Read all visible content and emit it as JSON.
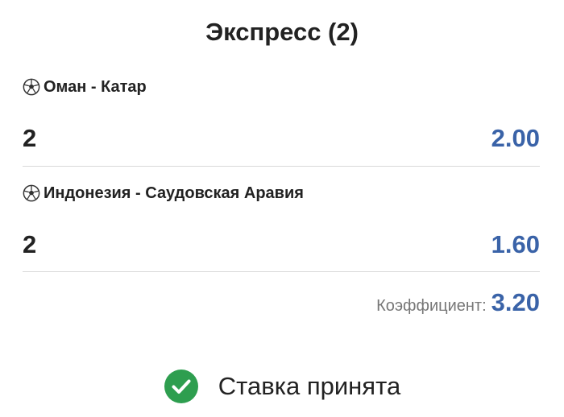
{
  "title": "Экспресс (2)",
  "bets": [
    {
      "icon": "soccer-ball-icon",
      "match": "Оман - Катар",
      "outcome": "2",
      "odds": "2.00"
    },
    {
      "icon": "soccer-ball-icon",
      "match": "Индонезия - Саудовская Аравия",
      "outcome": "2",
      "odds": "1.60"
    }
  ],
  "summary": {
    "label": "Коэффициент:",
    "value": "3.20"
  },
  "status": {
    "icon": "check-circle-icon",
    "text": "Ставка принята"
  },
  "colors": {
    "accent": "#3a63a8",
    "success": "#2e9e4f",
    "divider": "#d9d9d9"
  }
}
